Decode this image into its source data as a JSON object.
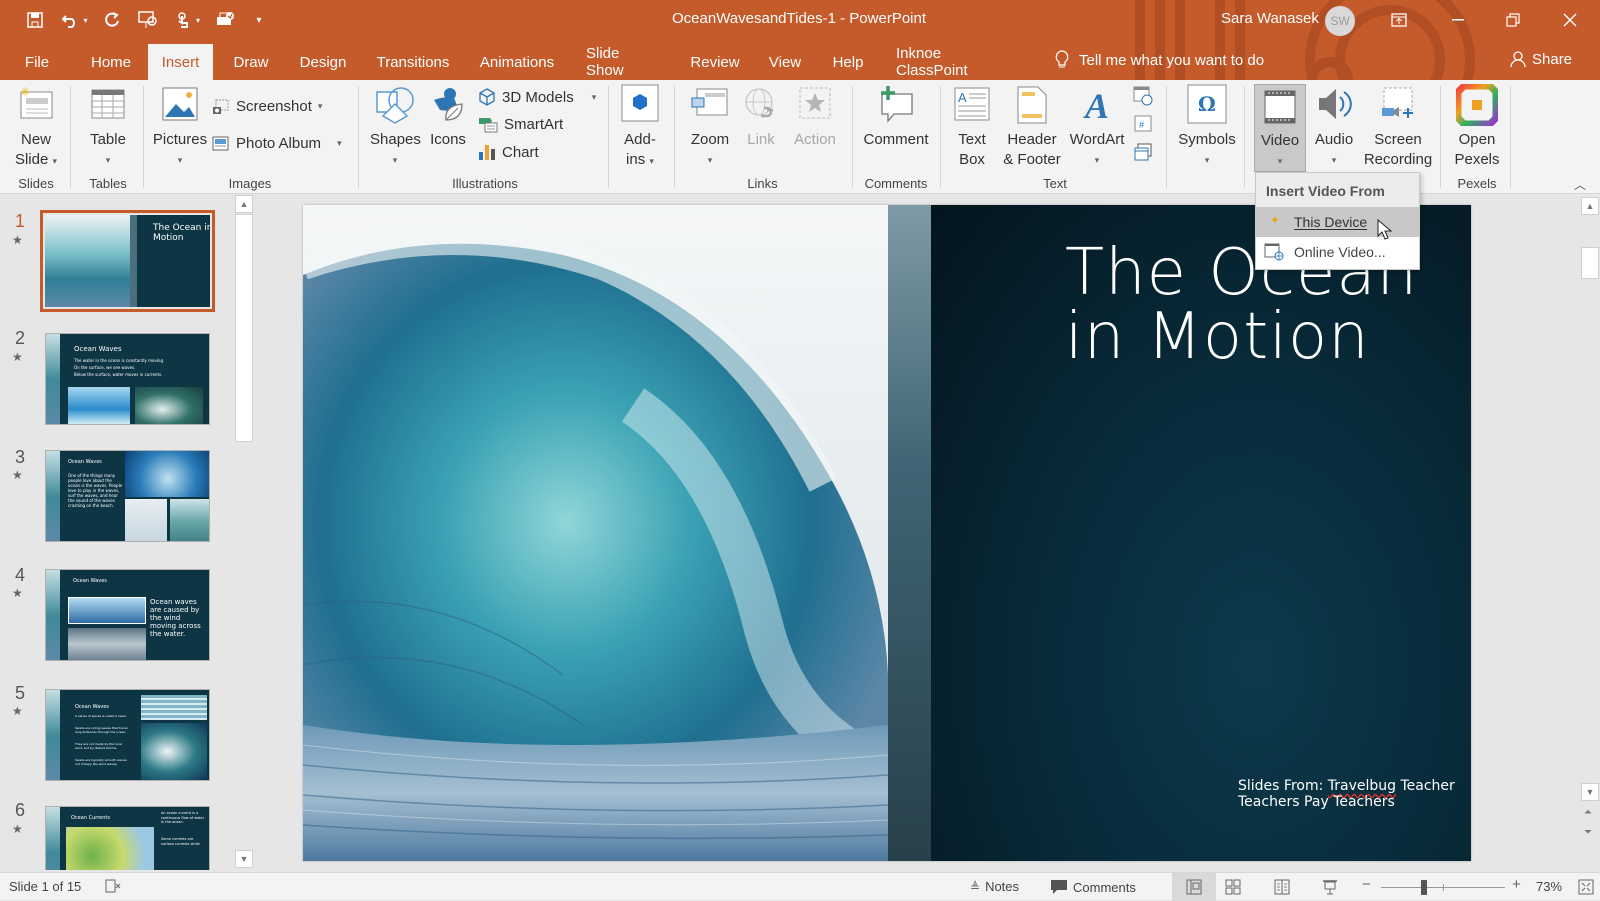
{
  "window": {
    "document_title": "OceanWavesandTides-1  -  PowerPoint",
    "user_name": "Sara Wanasek",
    "user_initials": "SW"
  },
  "quick_access": [
    "save",
    "undo",
    "redo",
    "present-from-start",
    "touch-mode",
    "print-preview",
    "customize"
  ],
  "tabs": [
    {
      "label": "File"
    },
    {
      "label": "Home"
    },
    {
      "label": "Insert",
      "active": true
    },
    {
      "label": "Draw"
    },
    {
      "label": "Design"
    },
    {
      "label": "Transitions"
    },
    {
      "label": "Animations"
    },
    {
      "label": "Slide Show"
    },
    {
      "label": "Review"
    },
    {
      "label": "View"
    },
    {
      "label": "Help"
    },
    {
      "label": "Inknoe ClassPoint"
    }
  ],
  "tell_me": "Tell me what you want to do",
  "share": "Share",
  "ribbon": {
    "groups": {
      "slides": "Slides",
      "tables": "Tables",
      "images": "Images",
      "illustrations": "Illustrations",
      "links": "Links",
      "comments": "Comments",
      "text": "Text",
      "pexels": "Pexels"
    },
    "new_slide": [
      "New",
      "Slide"
    ],
    "table": "Table",
    "pictures": "Pictures",
    "screenshot": "Screenshot",
    "photo_album": "Photo Album",
    "shapes": "Shapes",
    "icons": "Icons",
    "models_3d": "3D Models",
    "smartart": "SmartArt",
    "chart": "Chart",
    "addins": [
      "Add-",
      "ins"
    ],
    "zoom": "Zoom",
    "link": "Link",
    "action": "Action",
    "comment": "Comment",
    "text_box": [
      "Text",
      "Box"
    ],
    "header_footer": [
      "Header",
      "& Footer"
    ],
    "wordart": "WordArt",
    "symbols": "Symbols",
    "video": "Video",
    "audio": "Audio",
    "screen_recording": [
      "Screen",
      "Recording"
    ],
    "open_pexels": [
      "Open",
      "Pexels"
    ]
  },
  "video_menu": {
    "header": "Insert Video From",
    "items": [
      {
        "label": "This Device",
        "hovered": true
      },
      {
        "label": "Online Video..."
      }
    ]
  },
  "thumbnails": [
    {
      "num": "1",
      "title": "The Ocean in Motion",
      "active": true
    },
    {
      "num": "2",
      "title": "Ocean Waves",
      "bullets": [
        "The water in the ocean is constantly moving",
        "On the surface, we see waves.",
        "Below the surface, water moves in currents."
      ]
    },
    {
      "num": "3",
      "title": "Ocean Waves",
      "bullets": [
        "One of the things many people love about the ocean is the waves. People love to play in the waves, surf the waves, and hear the sound of the waves crashing on the beach."
      ]
    },
    {
      "num": "4",
      "title": "Ocean Waves",
      "bullets": [
        "Ocean waves are caused by the wind moving across the water."
      ]
    },
    {
      "num": "5",
      "title": "Ocean Waves",
      "bullets": [
        "A series of waves is called a swell.",
        "Swells are rolling waves that travel long distances through the ocean.",
        "They are not made by the local wind, but by distant storms.",
        "Swells are typically smooth waves, not choppy like wind waves."
      ]
    },
    {
      "num": "6",
      "title": "Ocean Currents",
      "bullets": [
        "An ocean current is a continuous flow of water in the ocean.",
        "Some currents are surface currents while"
      ]
    }
  ],
  "slide": {
    "title_line1": "The Ocean",
    "title_line2": "in Motion",
    "credit_prefix": "Slides From: ",
    "credit_name": "Travelbug",
    "credit_suffix": " Teacher",
    "credit_line2": "Teachers Pay Teachers"
  },
  "statusbar": {
    "slide_counter": "Slide 1 of 15",
    "notes": "Notes",
    "comments": "Comments",
    "zoom_level": "73%",
    "zoom_fraction": 0.35
  },
  "colors": {
    "accent": "#c55a2b",
    "ribbon_bg": "#f3f3f3",
    "slide_dark": "#0a2a38"
  }
}
